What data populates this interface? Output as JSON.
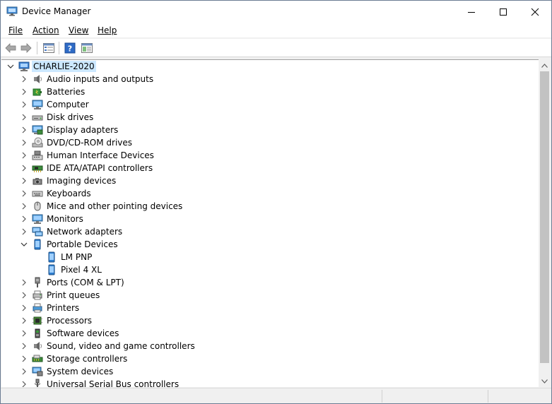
{
  "window": {
    "title": "Device Manager"
  },
  "menu": {
    "file": "File",
    "action": "Action",
    "view": "View",
    "help": "Help"
  },
  "toolbar": {
    "icons": [
      "back-arrow-icon",
      "forward-arrow-icon",
      "properties-icon",
      "help-icon",
      "view-icon"
    ]
  },
  "tree": {
    "root": "CHARLIE-2020",
    "categories": [
      {
        "label": "Audio inputs and outputs",
        "icon": "speaker-icon",
        "expanded": false
      },
      {
        "label": "Batteries",
        "icon": "battery-icon",
        "expanded": false
      },
      {
        "label": "Computer",
        "icon": "computer-icon",
        "expanded": false
      },
      {
        "label": "Disk drives",
        "icon": "disk-drive-icon",
        "expanded": false
      },
      {
        "label": "Display adapters",
        "icon": "display-adapter-icon",
        "expanded": false
      },
      {
        "label": "DVD/CD-ROM drives",
        "icon": "dvd-drive-icon",
        "expanded": false
      },
      {
        "label": "Human Interface Devices",
        "icon": "hid-icon",
        "expanded": false
      },
      {
        "label": "IDE ATA/ATAPI controllers",
        "icon": "ide-controller-icon",
        "expanded": false
      },
      {
        "label": "Imaging devices",
        "icon": "camera-icon",
        "expanded": false
      },
      {
        "label": "Keyboards",
        "icon": "keyboard-icon",
        "expanded": false
      },
      {
        "label": "Mice and other pointing devices",
        "icon": "mouse-icon",
        "expanded": false
      },
      {
        "label": "Monitors",
        "icon": "monitor-icon",
        "expanded": false
      },
      {
        "label": "Network adapters",
        "icon": "network-icon",
        "expanded": false
      },
      {
        "label": "Portable Devices",
        "icon": "portable-device-icon",
        "expanded": true,
        "children": [
          "LM PNP",
          "Pixel 4 XL"
        ]
      },
      {
        "label": "Ports (COM & LPT)",
        "icon": "port-icon",
        "expanded": false
      },
      {
        "label": "Print queues",
        "icon": "print-queue-icon",
        "expanded": false
      },
      {
        "label": "Printers",
        "icon": "printer-icon",
        "expanded": false
      },
      {
        "label": "Processors",
        "icon": "processor-icon",
        "expanded": false
      },
      {
        "label": "Software devices",
        "icon": "software-device-icon",
        "expanded": false
      },
      {
        "label": "Sound, video and game controllers",
        "icon": "sound-icon",
        "expanded": false
      },
      {
        "label": "Storage controllers",
        "icon": "storage-controller-icon",
        "expanded": false
      },
      {
        "label": "System devices",
        "icon": "system-device-icon",
        "expanded": false
      },
      {
        "label": "Universal Serial Bus controllers",
        "icon": "usb-icon",
        "expanded": false
      }
    ]
  },
  "colors": {
    "selection": "#cce8ff",
    "accent": "#0078d7"
  }
}
